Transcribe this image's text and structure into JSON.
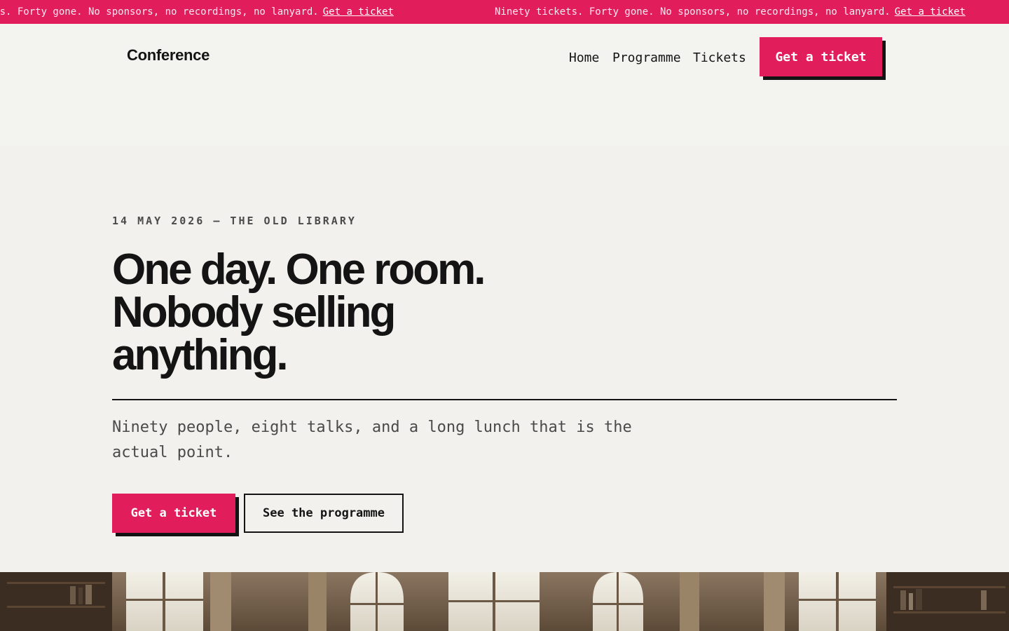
{
  "ticker": {
    "message": "Ninety tickets. Forty gone. No sponsors, no recordings, no lanyard.",
    "link": "Get a ticket"
  },
  "header": {
    "logo": "Conference",
    "nav": [
      "Home",
      "Programme",
      "Tickets"
    ],
    "cta": "Get a ticket"
  },
  "hero": {
    "eyebrow": "14 MAY 2026 — THE OLD LIBRARY",
    "headline": "One day. One room. Nobody selling anything.",
    "lede": "Ninety people, eight talks, and a long lunch that is the actual point.",
    "primary_button": "Get a ticket",
    "secondary_button": "See the programme"
  },
  "colors": {
    "accent": "#e11d5c",
    "ink": "#141414",
    "background": "#f3f3f0"
  }
}
